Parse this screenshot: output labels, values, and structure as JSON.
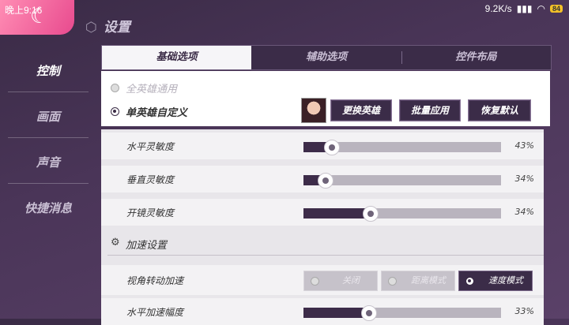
{
  "statusbar": {
    "time": "晚上9:16",
    "speed": "9.2K/s",
    "battery": "84"
  },
  "page": {
    "title": "设置"
  },
  "sidebar": {
    "items": [
      {
        "label": "控制"
      },
      {
        "label": "画面"
      },
      {
        "label": "声音"
      },
      {
        "label": "快捷消息"
      }
    ]
  },
  "tabs": [
    {
      "label": "基础选项"
    },
    {
      "label": "辅助选项"
    },
    {
      "label": "控件布局"
    }
  ],
  "hero_panel": {
    "option_all": "全英雄通用",
    "option_custom": "单英雄自定义",
    "btn_change": "更换英雄",
    "btn_batch": "批量应用",
    "btn_reset": "恢复默认"
  },
  "sensitivity": [
    {
      "label": "水平灵敏度",
      "percent": "43%",
      "value": 0.14
    },
    {
      "label": "垂直灵敏度",
      "percent": "34%",
      "value": 0.11
    },
    {
      "label": "开镜灵敏度",
      "percent": "34%",
      "value": 0.34
    }
  ],
  "accel_section": {
    "title": "加速设置",
    "turn_accel": {
      "label": "视角转动加速",
      "options": [
        "关闭",
        "距离模式",
        "速度模式"
      ],
      "selected": "速度模式"
    },
    "horizontal_accel": {
      "label": "水平加速幅度",
      "percent": "33%",
      "value": 0.33
    }
  }
}
